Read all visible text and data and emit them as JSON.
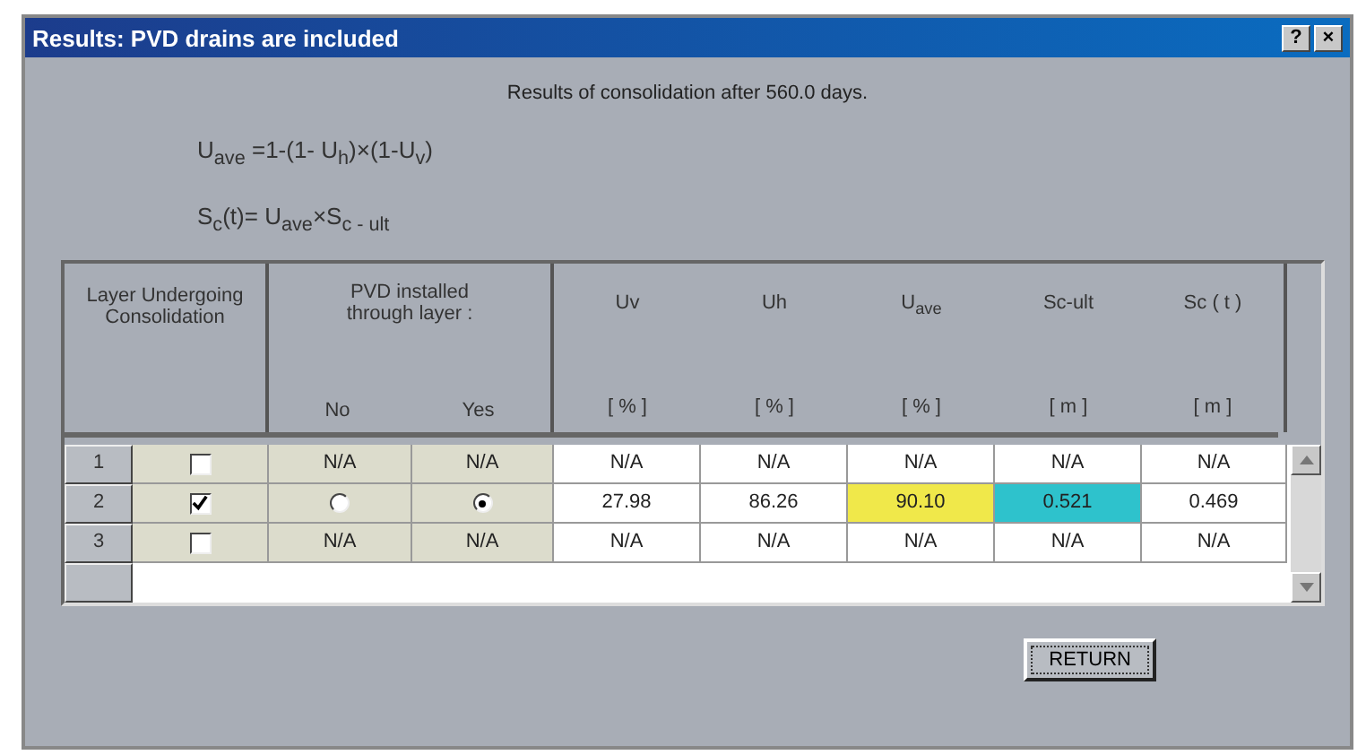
{
  "window": {
    "title": "Results:  PVD drains are included",
    "help_button": "?",
    "close_button": "×"
  },
  "summary": "Results of consolidation after 560.0 days.",
  "formulas": [
    "U$_{ave}$ =1-(1- U$_{h}$)×(1-U$_{v}$)",
    "S$_{c}$(t)= U$_{ave}$×S$_{c - ult}$"
  ],
  "table": {
    "layer_header": "Layer Undergoing Consolidation",
    "pvd_header": "PVD installed through layer :",
    "pvd_no": "No",
    "pvd_yes": "Yes",
    "columns": [
      {
        "name": "Uv",
        "unit": "[ % ]"
      },
      {
        "name": "Uh",
        "unit": "[ % ]"
      },
      {
        "name": "U$_{ave}$",
        "unit": "[ % ]"
      },
      {
        "name": "Sc-ult",
        "unit": "[ m ]"
      },
      {
        "name": "Sc ( t )",
        "unit": "[ m ]"
      }
    ],
    "rows": [
      {
        "index": "1",
        "checked": false,
        "pvd": {
          "kind": "text",
          "no": "N/A",
          "yes": "N/A"
        },
        "values": [
          {
            "text": "N/A"
          },
          {
            "text": "N/A"
          },
          {
            "text": "N/A"
          },
          {
            "text": "N/A"
          },
          {
            "text": "N/A"
          }
        ]
      },
      {
        "index": "2",
        "checked": true,
        "pvd": {
          "kind": "radio",
          "no_selected": false,
          "yes_selected": true
        },
        "values": [
          {
            "text": "27.98"
          },
          {
            "text": "86.26"
          },
          {
            "text": "90.10",
            "color": "#f0e84a"
          },
          {
            "text": "0.521",
            "color": "#2ec2cc"
          },
          {
            "text": "0.469"
          }
        ]
      },
      {
        "index": "3",
        "checked": false,
        "pvd": {
          "kind": "text",
          "no": "N/A",
          "yes": "N/A"
        },
        "values": [
          {
            "text": "N/A"
          },
          {
            "text": "N/A"
          },
          {
            "text": "N/A"
          },
          {
            "text": "N/A"
          },
          {
            "text": "N/A"
          }
        ]
      }
    ]
  },
  "buttons": [
    "RETURN"
  ]
}
